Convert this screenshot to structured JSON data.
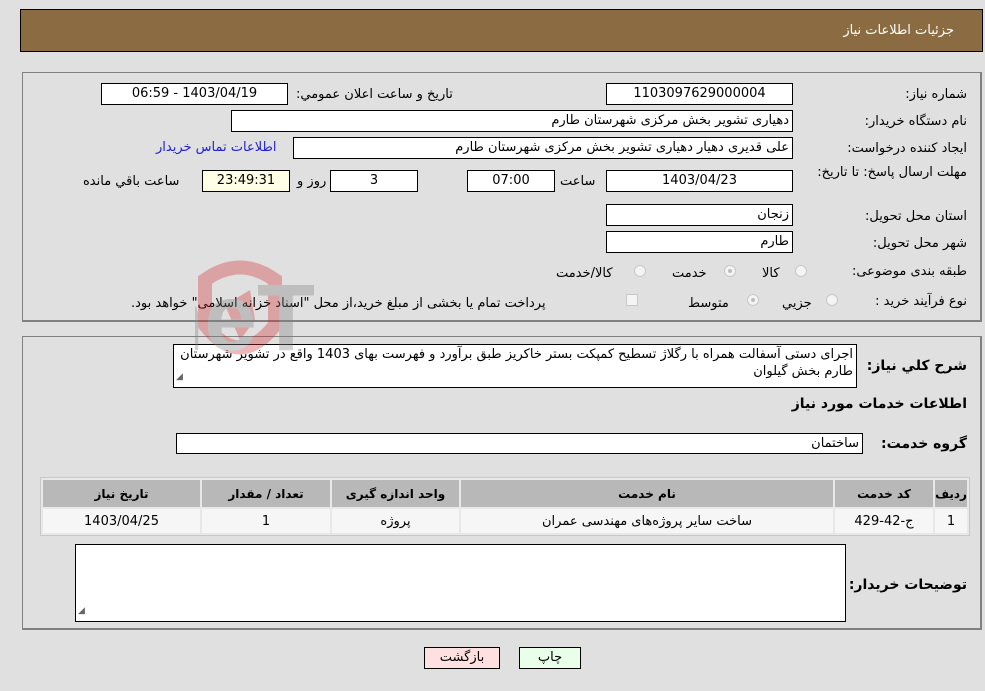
{
  "header": {
    "title": "جزئیات اطلاعات نیاز"
  },
  "form": {
    "need_number": {
      "label": "شماره نیاز:",
      "value": "1103097629000004"
    },
    "announce_datetime": {
      "label": "تاریخ و ساعت اعلان عمومي:",
      "value": "1403/04/19 - 06:59"
    },
    "buyer_org": {
      "label": "نام دستگاه خریدار:",
      "value": "دهیاری تشویر بخش مرکزی شهرستان طارم"
    },
    "requester": {
      "label": "ایجاد کننده درخواست:",
      "value": "علی قدیری دهیار دهیاری تشویر بخش مرکزی شهرستان طارم"
    },
    "contact_link": "اطلاعات تماس خریدار",
    "deadline": {
      "label": "مهلت ارسال پاسخ: تا تاریخ:",
      "date": "1403/04/23",
      "time_label": "ساعت",
      "time": "07:00",
      "days": "3",
      "days_label": "روز و",
      "remaining": "23:49:31",
      "remaining_label": "ساعت باقي مانده"
    },
    "province": {
      "label": "استان محل تحویل:",
      "value": "زنجان"
    },
    "city": {
      "label": "شهر محل تحویل:",
      "value": "طارم"
    },
    "category": {
      "label": "طبقه بندی موضوعی:",
      "options": [
        {
          "label": "کالا",
          "checked": false
        },
        {
          "label": "خدمت",
          "checked": true
        },
        {
          "label": "کالا/خدمت",
          "checked": false
        }
      ]
    },
    "process": {
      "label": "نوع فرآیند خرید :",
      "options": [
        {
          "label": "جزيي",
          "checked": false
        },
        {
          "label": "متوسط",
          "checked": true
        }
      ],
      "treasury_note": "پرداخت تمام یا بخشی از مبلغ خرید،از محل \"اسناد خزانه اسلامی\" خواهد بود.",
      "treasury_checked": false
    }
  },
  "details": {
    "description_label": "شرح کلي نیاز:",
    "description": "اجرای دستی آسفالت همراه با رگلاژ تسطیح کمپکت بستر خاکریز طبق برآورد و فهرست بهای 1403 واقع در تشویر شهرستان طارم بخش گیلوان",
    "services_heading": "اطلاعات خدمات مورد نیاز",
    "service_group_label": "گروه خدمت:",
    "service_group": "ساختمان",
    "table": {
      "headers": [
        "ردیف",
        "کد خدمت",
        "نام خدمت",
        "واحد اندازه گیری",
        "تعداد / مقدار",
        "تاریخ نیاز"
      ],
      "rows": [
        [
          "1",
          "ج-42-429",
          "ساخت سایر پروژه‌های مهندسی عمران",
          "پروژه",
          "1",
          "1403/04/25"
        ]
      ]
    },
    "buyer_notes_label": "توضیحات خریدار:",
    "buyer_notes": ""
  },
  "buttons": {
    "print": "چاپ",
    "back": "بازگشت"
  },
  "watermark": "AriaTender.neT",
  "colors": {
    "header_bg": "#8b6c42",
    "print_bg": "#eaffea",
    "back_bg": "#ffe0e0",
    "link": "#2222cc"
  }
}
